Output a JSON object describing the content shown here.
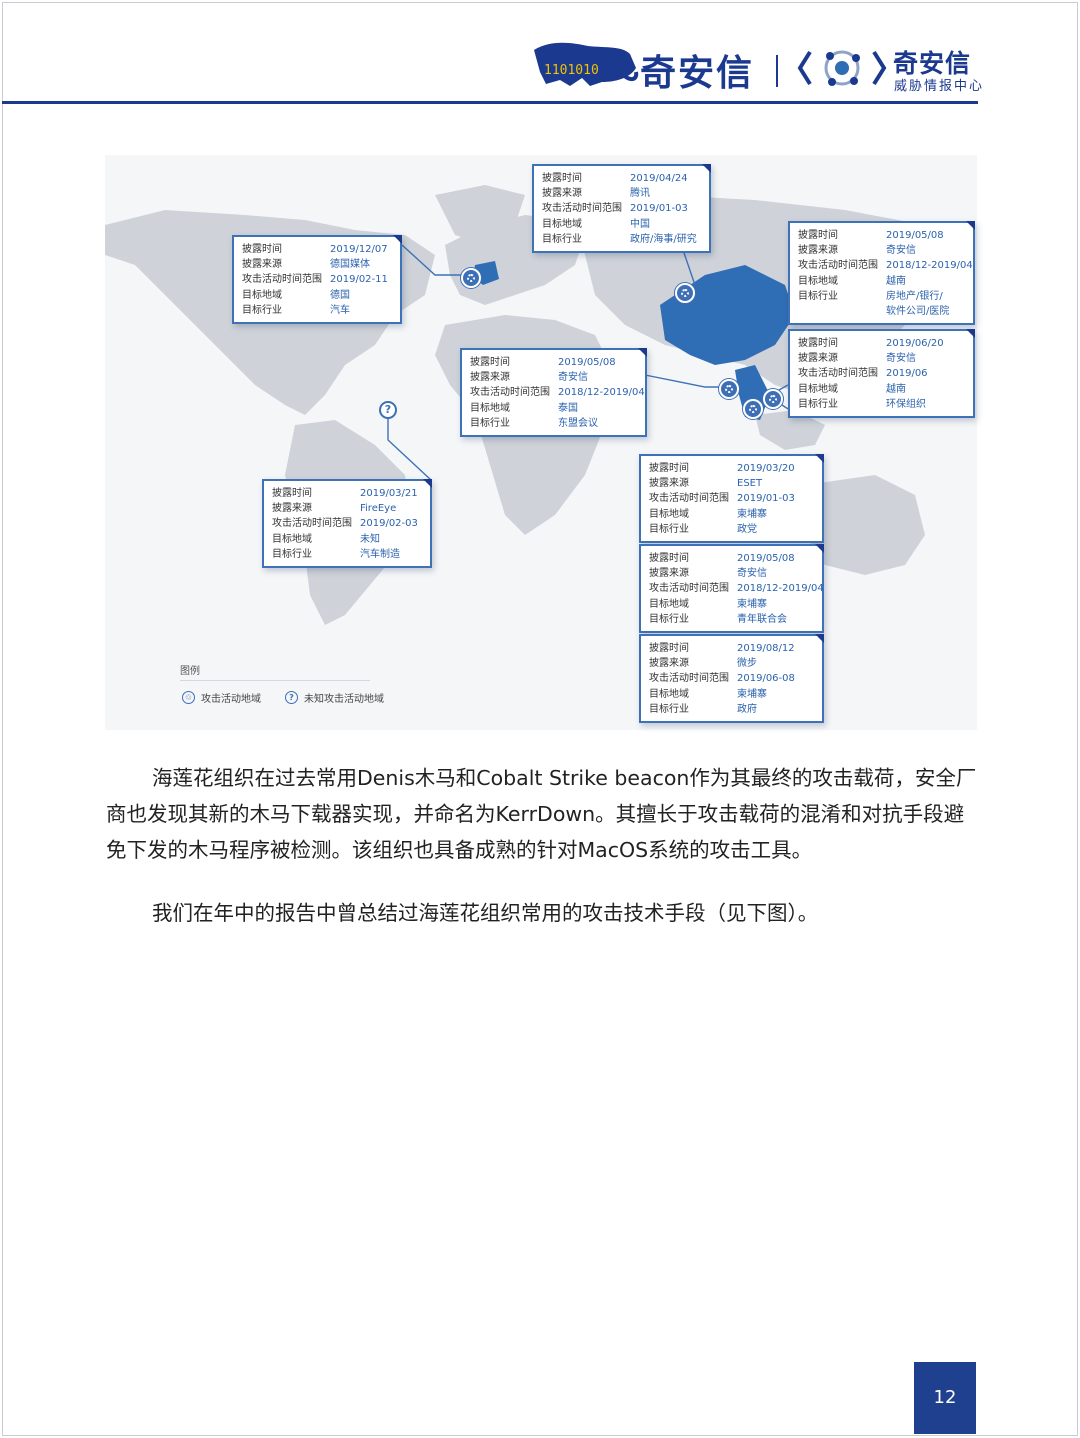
{
  "header": {
    "logo_digits": "1101010",
    "brand_name": "奇安信",
    "brand2_name": "奇安信",
    "brand2_sub": "威胁情报中心"
  },
  "map": {
    "field_labels": [
      "披露时间",
      "披露来源",
      "攻击活动时间范围",
      "目标地域",
      "目标行业"
    ],
    "cards": [
      {
        "values": [
          "2019/04/24",
          "腾讯",
          "2019/01-03",
          "中国",
          "政府/海事/研究"
        ]
      },
      {
        "values": [
          "2019/12/07",
          "德国媒体",
          "2019/02-11",
          "德国",
          "汽车"
        ]
      },
      {
        "values": [
          "2019/05/08",
          "奇安信",
          "2018/12-2019/04",
          "越南",
          "房地产/银行/\n软件公司/医院"
        ]
      },
      {
        "values": [
          "2019/06/20",
          "奇安信",
          "2019/06",
          "越南",
          "环保组织"
        ]
      },
      {
        "values": [
          "2019/05/08",
          "奇安信",
          "2018/12-2019/04",
          "泰国",
          "东盟会议"
        ]
      },
      {
        "values": [
          "2019/03/21",
          "FireEye",
          "2019/02-03",
          "未知",
          "汽车制造"
        ]
      },
      {
        "values": [
          "2019/03/20",
          "ESET",
          "2019/01-03",
          "柬埔寨",
          "政党"
        ]
      },
      {
        "values": [
          "2019/05/08",
          "奇安信",
          "2018/12-2019/04",
          "柬埔寨",
          "青年联合会"
        ]
      },
      {
        "values": [
          "2019/08/12",
          "微步",
          "2019/06-08",
          "柬埔寨",
          "政府"
        ]
      }
    ],
    "legend": {
      "title": "图例",
      "item1": "攻击活动地域",
      "item2": "未知攻击活动地域"
    },
    "colors": {
      "highlight": "#2f6db5",
      "land": "#cfd3d9",
      "card_border": "#3d72b8"
    }
  },
  "body": {
    "paragraph1": "海莲花组织在过去常用Denis木马和Cobalt Strike beacon作为其最终的攻击载荷，安全厂商也发现其新的木马下载器实现，并命名为KerrDown。其擅长于攻击载荷的混淆和对抗手段避免下发的木马程序被检测。该组织也具备成熟的针对MacOS系统的攻击工具。",
    "paragraph2": "我们在年中的报告中曾总结过海莲花组织常用的攻击技术手段（见下图）。"
  },
  "page_number": "12"
}
